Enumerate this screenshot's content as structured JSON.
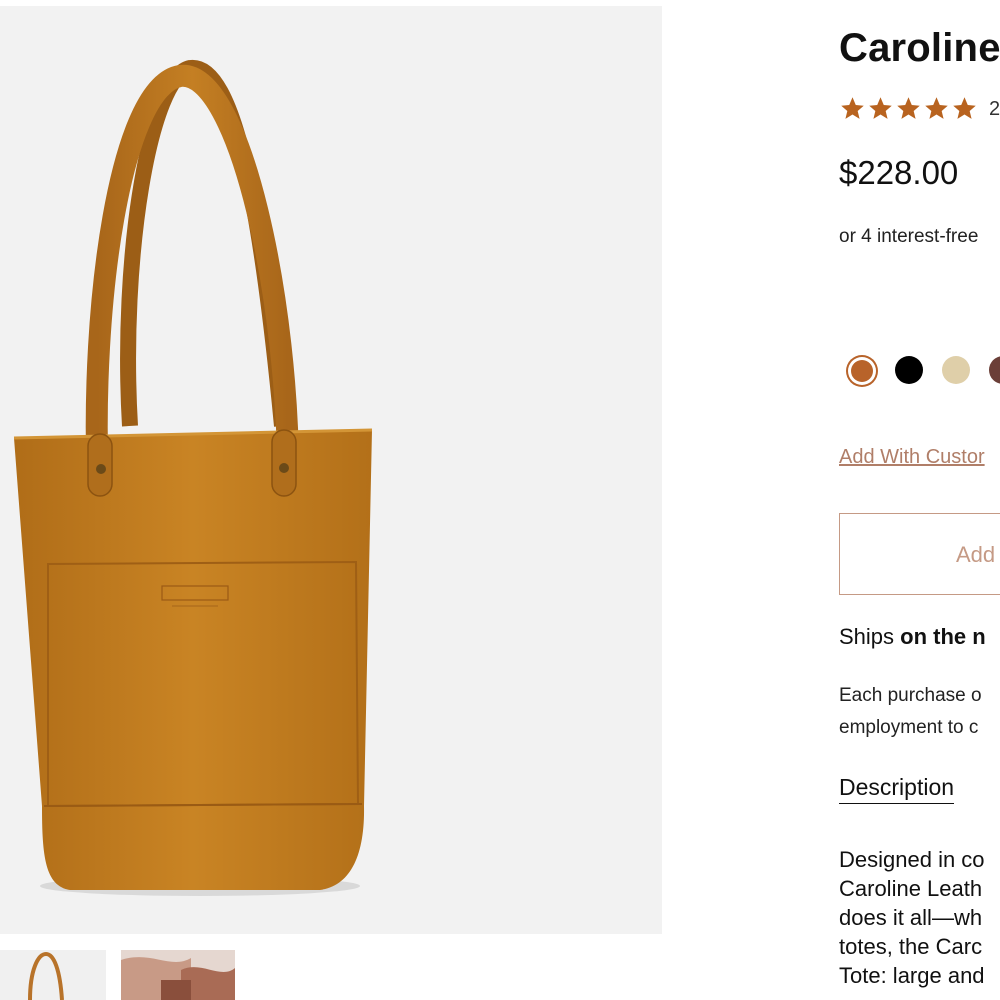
{
  "product": {
    "title": "Caroline",
    "rating_stars": 5,
    "review_count": "2",
    "price": "$228.00",
    "installments": "or 4 interest-free",
    "colors": [
      {
        "name": "cognac",
        "hex": "#b8632a",
        "selected": true
      },
      {
        "name": "black",
        "hex": "#000000",
        "selected": false
      },
      {
        "name": "cream",
        "hex": "#dfcfa9",
        "selected": false
      },
      {
        "name": "brown",
        "hex": "#6b3f38",
        "selected": false
      }
    ],
    "custom_link": "Add With Custor",
    "add_button": "Add",
    "shipping": {
      "prefix": "Ships ",
      "bold": "on the n"
    },
    "purchase_lines": [
      "Each purchase o",
      "employment to c"
    ],
    "description_tab": "Description",
    "description_lines": [
      "Designed in co",
      "Caroline Leath",
      "does it all—wh",
      "totes, the Carc",
      "Tote: large and"
    ]
  },
  "gallery": {
    "main_image": "leather-tote-bag",
    "thumbnails": [
      "tote-thumbnail",
      "hands-thumbnail"
    ]
  },
  "colors": {
    "accent": "#b8632a",
    "link": "#b07e68",
    "button_border": "#c59a85",
    "star": "#b8631f",
    "gallery_bg": "#f2f2f2"
  }
}
